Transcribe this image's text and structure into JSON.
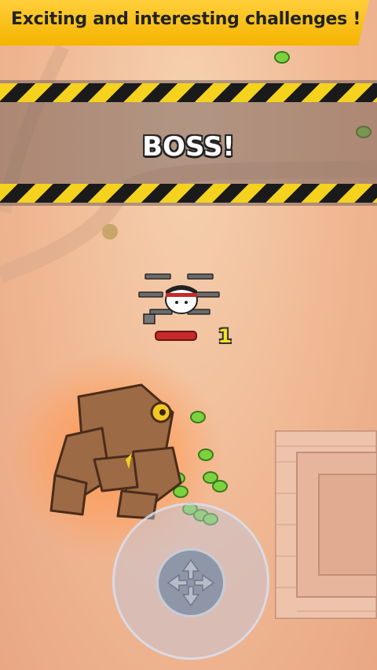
{
  "banner": {
    "text": "Exciting and interesting challenges !"
  },
  "boss_alert": {
    "text": "BOSS!"
  },
  "player": {
    "combo_counter": "1",
    "health_level": 1.0
  },
  "colors": {
    "banner": "#f5b400",
    "hazard_yellow": "#f4d21e",
    "hazard_black": "#1a1a1a",
    "health": "#c42a2a",
    "slime": "#6fcf3a",
    "golem": "#8a5a3a"
  },
  "icons": [
    "move-arrows-icon",
    "rifle-icon",
    "pistol-icon",
    "slime-icon"
  ]
}
